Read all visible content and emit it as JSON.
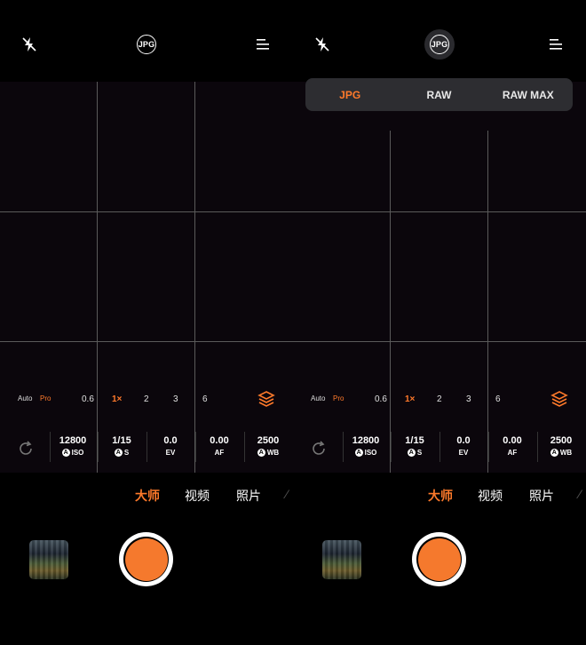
{
  "left": {
    "format_badge": "JPG",
    "zoom": {
      "auto": "Auto",
      "pro": "Pro",
      "levels": [
        "0.6",
        "1×",
        "2",
        "3",
        "6"
      ]
    },
    "params": [
      {
        "value": "12800",
        "label": "ISO",
        "auto": "A"
      },
      {
        "value": "1/15",
        "label": "S",
        "auto": "A"
      },
      {
        "value": "0.0",
        "label": "EV"
      },
      {
        "value": "0.00",
        "label": "AF"
      },
      {
        "value": "2500",
        "label": "WB",
        "auto": "A"
      }
    ],
    "modes": [
      "大师",
      "视频",
      "照片"
    ]
  },
  "right": {
    "format_badge": "JPG",
    "format_menu": [
      "JPG",
      "RAW",
      "RAW MAX"
    ],
    "zoom": {
      "auto": "Auto",
      "pro": "Pro",
      "levels": [
        "0.6",
        "1×",
        "2",
        "3",
        "6"
      ]
    },
    "params": [
      {
        "value": "12800",
        "label": "ISO",
        "auto": "A"
      },
      {
        "value": "1/15",
        "label": "S",
        "auto": "A"
      },
      {
        "value": "0.0",
        "label": "EV"
      },
      {
        "value": "0.00",
        "label": "AF"
      },
      {
        "value": "2500",
        "label": "WB",
        "auto": "A"
      }
    ],
    "modes": [
      "大师",
      "视频",
      "照片"
    ]
  },
  "colors": {
    "accent": "#ff7a2b",
    "shutter": "#f5792d",
    "viewfinder": "#0b060c"
  },
  "icons": [
    "flash-off-icon",
    "jpg-format-icon",
    "menu-icon",
    "layers-icon",
    "reset-icon"
  ]
}
